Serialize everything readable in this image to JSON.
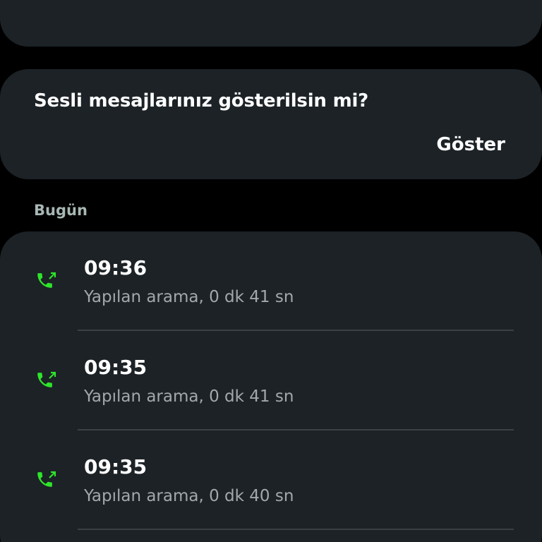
{
  "colors": {
    "background": "#000000",
    "card": "#1c2226",
    "accent_green": "#2ee52a",
    "section_header": "#a7b7b4",
    "secondary_text": "#a3a8ab"
  },
  "quick_actions": [
    {
      "icon": "phone-icon"
    },
    {
      "icon": "message-icon"
    },
    {
      "icon": "video-icon"
    }
  ],
  "voicemail": {
    "question": "Sesli mesajlarınız gösterilsin mi?",
    "show_label": "Göster"
  },
  "section": {
    "title": "Bugün"
  },
  "calls": [
    {
      "time": "09:36",
      "detail": "Yapılan arama, 0 dk 41 sn",
      "icon": "outgoing-call-icon"
    },
    {
      "time": "09:35",
      "detail": "Yapılan arama, 0 dk 41 sn",
      "icon": "outgoing-call-icon"
    },
    {
      "time": "09:35",
      "detail": "Yapılan arama, 0 dk 40 sn",
      "icon": "outgoing-call-icon"
    }
  ]
}
